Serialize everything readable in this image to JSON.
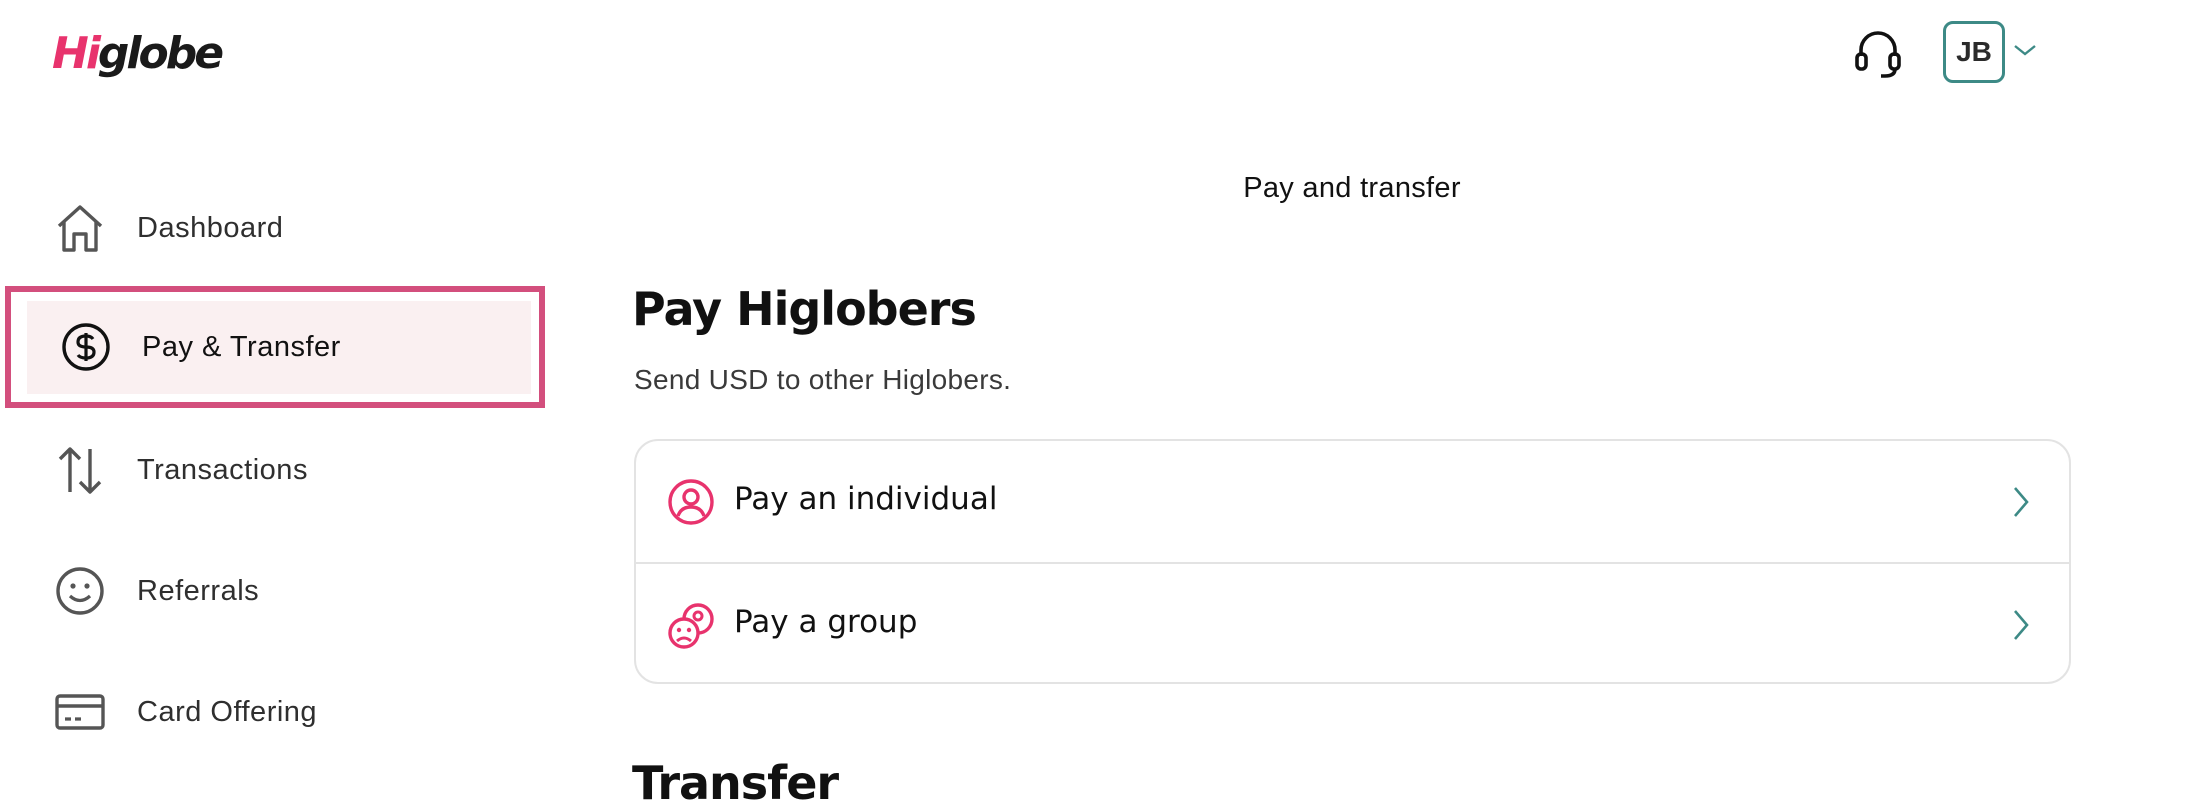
{
  "brand": {
    "logo_hi": "Hi",
    "logo_rest": "globe",
    "accent_color": "#e8336d"
  },
  "header": {
    "support_icon": "headset-icon",
    "avatar_initials": "JB",
    "avatar_border_color": "#3d8a86",
    "menu_icon": "chevron-down-icon"
  },
  "sidebar": {
    "items": [
      {
        "label": "Dashboard",
        "icon": "home-icon",
        "active": false
      },
      {
        "label": "Pay & Transfer",
        "icon": "dollar-circle-icon",
        "active": true
      },
      {
        "label": "Transactions",
        "icon": "arrows-up-down-icon",
        "active": false
      },
      {
        "label": "Referrals",
        "icon": "smiley-icon",
        "active": false
      },
      {
        "label": "Card Offering",
        "icon": "credit-card-icon",
        "active": false
      }
    ],
    "active_border_color": "#d34f7d"
  },
  "main": {
    "page_title": "Pay and transfer",
    "pay_section": {
      "title": "Pay Higlobers",
      "subtitle": "Send USD to other Higlobers.",
      "options": [
        {
          "label": "Pay an individual",
          "icon": "person-circle-icon"
        },
        {
          "label": "Pay a group",
          "icon": "group-icon"
        }
      ]
    },
    "transfer_section": {
      "title": "Transfer"
    }
  }
}
